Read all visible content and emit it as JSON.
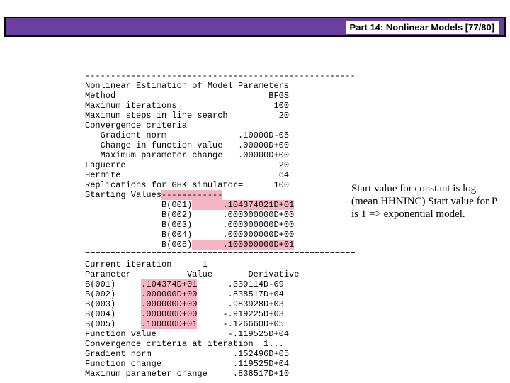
{
  "header": {
    "title": "Part 14: Nonlinear Models [77/80]"
  },
  "console": {
    "rule_dash": "-----------------------------------------------------",
    "title_line": "Nonlinear Estimation of Model Parameters",
    "method_line": "Method                              BFGS",
    "maxiter_line": "Maximum iterations                   100",
    "maxsteps_line": "Maximum steps in line search          20",
    "conv_header": "Convergence criteria",
    "grad_norm_line": "   Gradient norm              .10000D-05",
    "chg_fval_line": "   Change in function value   .00000D+00",
    "max_parm_chg_line": "   Maximum parameter change   .00000D+00",
    "laguerre_line": "Laguerre                              20",
    "hermite_line": "Hermite                               64",
    "ghk_line": "Replications for GHK simulator=      100",
    "sv_label": "Starting Values",
    "sv_dash": "------------",
    "sv_b001_lbl": "               B(001)",
    "sv_b001_val": "      .104374021D+01",
    "sv_b002": "               B(002)      .000000000D+00",
    "sv_b003": "               B(003)      .000000000D+00",
    "sv_b004": "               B(004)      .000000000D+00",
    "sv_b005_lbl": "               B(005)",
    "sv_b005_val": "      .100000000D+01",
    "rule_eq": "=====================================================",
    "iter_line": "Current iteration      1",
    "param_header": "Parameter           Value       Derivative",
    "b001_lbl": "B(001)     ",
    "b001_val": ".104374D+01",
    "b001_der": "      .339114D-09",
    "b002_lbl": "B(002)     ",
    "b002_val": ".000000D+00",
    "b002_der": "      .838517D+04",
    "b003_lbl": "B(003)     ",
    "b003_val": ".000000D+00",
    "b003_der": "      .983928D+03",
    "b004_lbl": "B(004)     ",
    "b004_val": ".000000D+00",
    "b004_der": "     -.919225D+03",
    "b005_lbl": "B(005)     ",
    "b005_val": ".100000D+01",
    "b005_der": "     -.126660D+05",
    "fval_line": "Function value              -.119525D+04",
    "conv_at_iter": "Convergence criteria at iteration  1...",
    "grad_norm2": "Gradient norm                .152496D+05",
    "fchange_line": "Function change              .119525D+04",
    "max_parm_chg2": "Maximum parameter change     .838517D+10"
  },
  "annotation": {
    "text": "Start value for constant is log (mean HHNINC) Start value for P is 1 => exponential model."
  }
}
